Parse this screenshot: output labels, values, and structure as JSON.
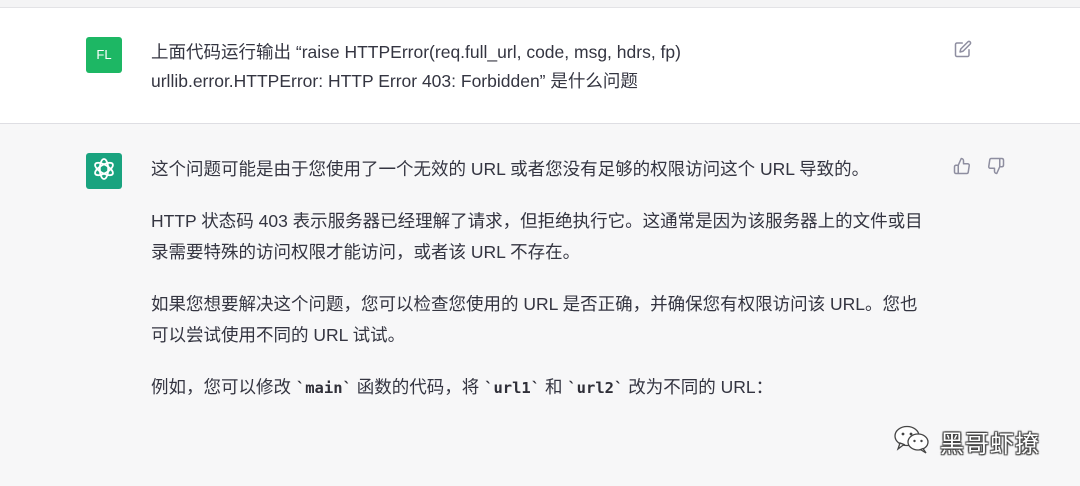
{
  "user_message": {
    "avatar_initials": "FL",
    "line1": "上面代码运行输出 “raise HTTPError(req.full_url, code, msg, hdrs, fp)",
    "line2": "urllib.error.HTTPError: HTTP Error 403: Forbidden” 是什么问题",
    "edit_icon": "edit-icon"
  },
  "assistant_message": {
    "avatar_icon": "openai-logo-icon",
    "paragraphs": [
      "这个问题可能是由于您使用了一个无效的 URL 或者您没有足够的权限访问这个 URL 导致的。",
      "HTTP 状态码 403 表示服务器已经理解了请求，但拒绝执行它。这通常是因为该服务器上的文件或目录需要特殊的访问权限才能访问，或者该 URL 不存在。",
      "如果您想要解决这个问题，您可以检查您使用的 URL 是否正确，并确保您有权限访问该 URL。您也可以尝试使用不同的 URL 试试。"
    ],
    "last_paragraph": {
      "prefix": "例如，您可以修改 ",
      "code1": "`main`",
      "mid1": " 函数的代码，将 ",
      "code2": "`url1`",
      "mid2": " 和 ",
      "code3": "`url2`",
      "suffix": " 改为不同的 URL："
    },
    "like_icon": "thumbs-up-icon",
    "dislike_icon": "thumbs-down-icon"
  },
  "watermark": {
    "text": "黑哥虾撩",
    "icon": "wechat-icon"
  },
  "colors": {
    "user_avatar_bg": "#1db764",
    "bot_avatar_bg": "#19a37f",
    "bot_message_bg": "#f7f7f8",
    "text": "#343541"
  }
}
